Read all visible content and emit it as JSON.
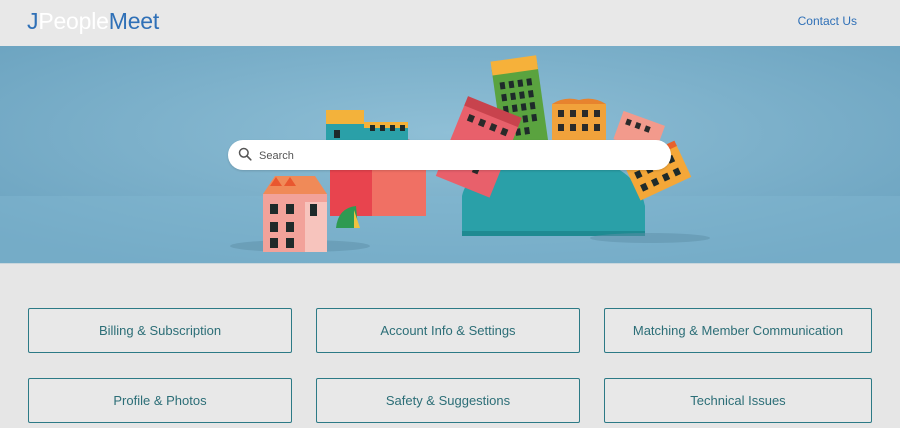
{
  "header": {
    "logo": {
      "j": "J",
      "people": "People",
      "meet": "Meet"
    },
    "contact_label": "Contact Us"
  },
  "hero": {
    "colors": {
      "sky": "#75abc6",
      "accent": "#2f70b7"
    }
  },
  "search": {
    "placeholder": "Search",
    "value": "",
    "icon": "search-icon"
  },
  "categories": [
    {
      "label": "Billing & Subscription"
    },
    {
      "label": "Account Info & Settings"
    },
    {
      "label": "Matching & Member Communication"
    },
    {
      "label": "Profile & Photos"
    },
    {
      "label": "Safety & Suggestions"
    },
    {
      "label": "Technical Issues"
    }
  ]
}
